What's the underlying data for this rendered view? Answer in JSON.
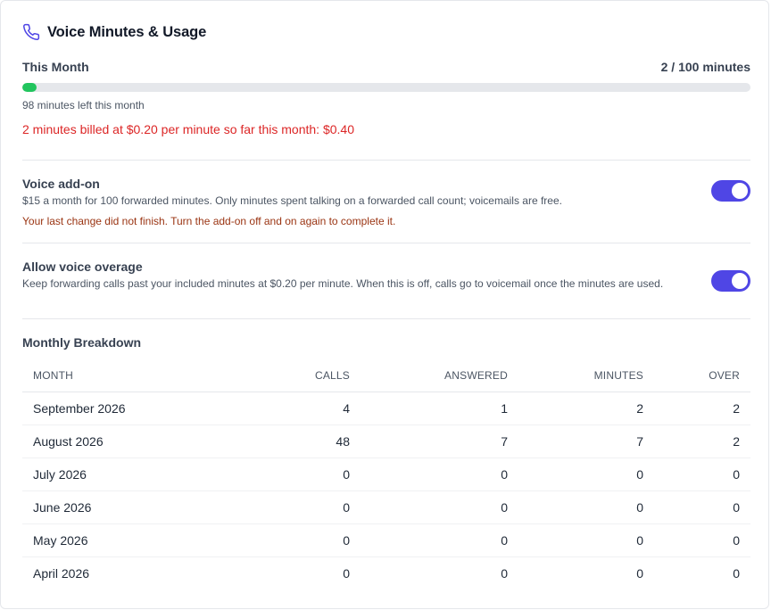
{
  "header": {
    "title": "Voice Minutes & Usage",
    "icon": "phone-icon",
    "icon_color": "#4f46e5"
  },
  "usage": {
    "label": "This Month",
    "used_display": "2 / 100 minutes",
    "used": 2,
    "total": 100,
    "progress_color": "#22c55e",
    "left_text": "98 minutes left this month",
    "billed_text": "2 minutes billed at $0.20 per minute so far this month: $0.40"
  },
  "voice_addon": {
    "title": "Voice add-on",
    "description": "$15 a month for 100 forwarded minutes. Only minutes spent talking on a forwarded call count; voicemails are free.",
    "warning": "Your last change did not finish. Turn the add-on off and on again to complete it.",
    "enabled": true
  },
  "overage": {
    "title": "Allow voice overage",
    "description": "Keep forwarding calls past your included minutes at $0.20 per minute. When this is off, calls go to voicemail once the minutes are used.",
    "enabled": true
  },
  "breakdown": {
    "title": "Monthly Breakdown",
    "columns": [
      "MONTH",
      "CALLS",
      "ANSWERED",
      "MINUTES",
      "OVER"
    ],
    "rows": [
      {
        "month": "September 2026",
        "calls": "4",
        "answered": "1",
        "minutes": "2",
        "over": "2"
      },
      {
        "month": "August 2026",
        "calls": "48",
        "answered": "7",
        "minutes": "7",
        "over": "2"
      },
      {
        "month": "July 2026",
        "calls": "0",
        "answered": "0",
        "minutes": "0",
        "over": "0"
      },
      {
        "month": "June 2026",
        "calls": "0",
        "answered": "0",
        "minutes": "0",
        "over": "0"
      },
      {
        "month": "May 2026",
        "calls": "0",
        "answered": "0",
        "minutes": "0",
        "over": "0"
      },
      {
        "month": "April 2026",
        "calls": "0",
        "answered": "0",
        "minutes": "0",
        "over": "0"
      }
    ]
  },
  "colors": {
    "toggle_on": "#4f46e5",
    "billed_text": "#dc2626",
    "warning_text": "#9a3412"
  }
}
